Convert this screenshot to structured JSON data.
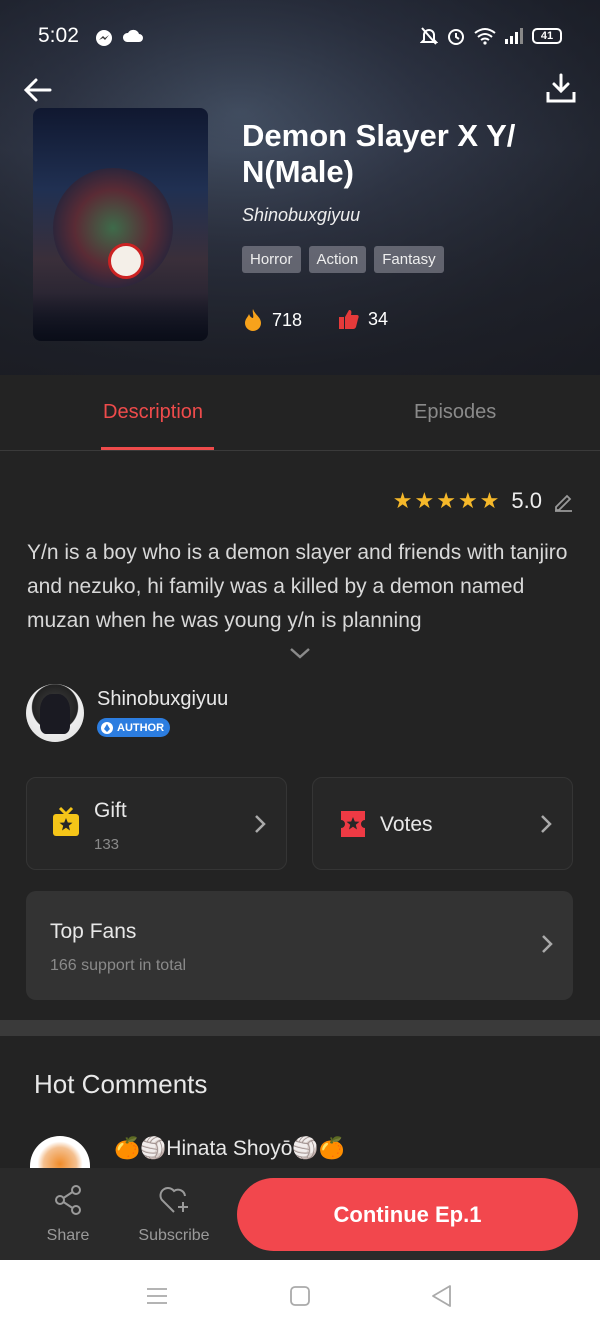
{
  "status_bar": {
    "time": "5:02",
    "battery": "41"
  },
  "book": {
    "title": "Demon Slayer X Y/ N(Male)",
    "author": "Shinobuxgiyuu",
    "tags": [
      "Horror",
      "Action",
      "Fantasy"
    ],
    "reads": "718",
    "likes": "34"
  },
  "tabs": [
    {
      "label": "Description",
      "active": true
    },
    {
      "label": "Episodes",
      "active": false
    }
  ],
  "rating": {
    "value": "5.0",
    "stars": 5
  },
  "description": "Y/n is a boy who is a demon slayer and friends with tanjiro and nezuko, hi family was a killed by a demon named muzan when he was young y/n is planning",
  "profile": {
    "name": "Shinobuxgiyuu",
    "badge": "AUTHOR"
  },
  "gift": {
    "label": "Gift",
    "count": "133"
  },
  "votes": {
    "label": "Votes"
  },
  "top_fans": {
    "label": "Top Fans",
    "subtitle": "166 support in total"
  },
  "hot_comments": {
    "title": "Hot Comments",
    "first_commenter": "🍊🏐Hinata Shoyō🏐🍊"
  },
  "bottom_bar": {
    "share": "Share",
    "subscribe": "Subscribe",
    "continue": "Continue Ep.1"
  },
  "colors": {
    "accent": "#f2474d",
    "tab_active": "#ee4b4b",
    "star": "#f5b82a",
    "badge": "#2c7de0"
  }
}
